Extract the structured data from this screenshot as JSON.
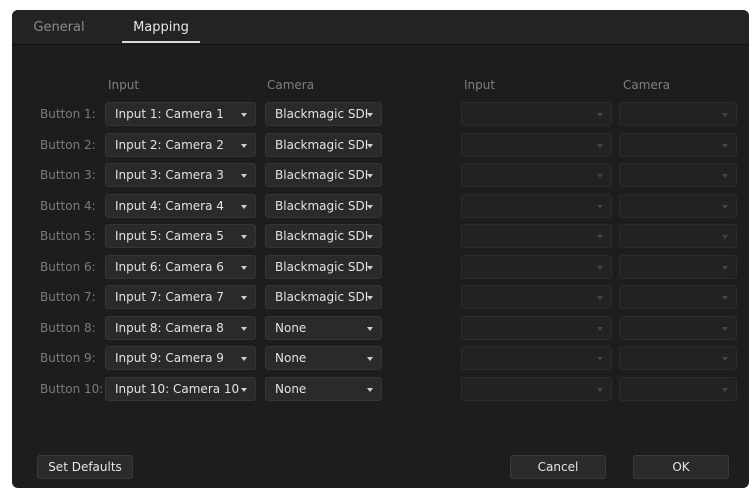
{
  "tabs": [
    {
      "label": "General",
      "active": false
    },
    {
      "label": "Mapping",
      "active": true
    }
  ],
  "headers": {
    "left_input": "Input",
    "left_camera": "Camera",
    "right_input": "Input",
    "right_camera": "Camera"
  },
  "rows": [
    {
      "label": "Button 1:",
      "input": "Input 1: Camera 1",
      "camera": "Blackmagic SDI"
    },
    {
      "label": "Button 2:",
      "input": "Input 2: Camera 2",
      "camera": "Blackmagic SDI"
    },
    {
      "label": "Button 3:",
      "input": "Input 3: Camera 3",
      "camera": "Blackmagic SDI"
    },
    {
      "label": "Button 4:",
      "input": "Input 4: Camera 4",
      "camera": "Blackmagic SDI"
    },
    {
      "label": "Button 5:",
      "input": "Input 5: Camera 5",
      "camera": "Blackmagic SDI"
    },
    {
      "label": "Button 6:",
      "input": "Input 6: Camera 6",
      "camera": "Blackmagic SDI"
    },
    {
      "label": "Button 7:",
      "input": "Input 7: Camera 7",
      "camera": "Blackmagic SDI"
    },
    {
      "label": "Button 8:",
      "input": "Input 8: Camera 8",
      "camera": "None"
    },
    {
      "label": "Button 9:",
      "input": "Input 9: Camera 9",
      "camera": "None"
    },
    {
      "label": "Button 10:",
      "input": "Input 10: Camera 10",
      "camera": "None"
    }
  ],
  "buttons": {
    "set_defaults": "Set Defaults",
    "cancel": "Cancel",
    "ok": "OK"
  },
  "colors": {
    "dialog_bg": "#1d1d1d",
    "dropdown_bg": "#2a2a2a",
    "text": "#e2e2e2",
    "label": "#7a7a7a"
  },
  "icons": {
    "dropdown_arrow": "chevron-down-icon"
  }
}
